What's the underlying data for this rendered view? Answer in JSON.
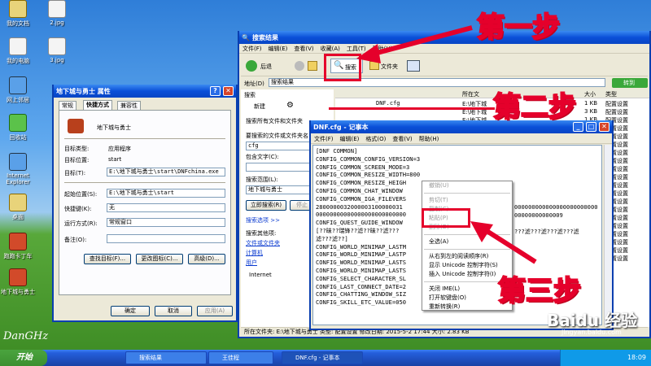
{
  "desktop": {
    "icons": [
      "我的文档",
      "2.jpg",
      "我的电脑",
      "3.jpg",
      "网上邻居",
      "回收站",
      "Internet Explorer",
      "桌面",
      "跑跑卡丁车",
      "地下城与勇士"
    ],
    "watermark": "Baidu 经验",
    "watermark_url": "jingyan.baidu.com",
    "signature": "DanGHz"
  },
  "properties": {
    "title": "地下城与勇士 属性",
    "tabs": [
      "常规",
      "快捷方式",
      "兼容性"
    ],
    "name": "地下城与勇士",
    "target_type_label": "目标类型:",
    "target_type": "应用程序",
    "target_location_label": "目标位置:",
    "target_location": "start",
    "target_label": "目标(T):",
    "target": "E:\\地下城与勇士\\start\\DNFchina.exe",
    "start_in_label": "起始位置(S):",
    "start_in": "E:\\地下城与勇士\\start",
    "shortcut_key_label": "快捷键(K):",
    "shortcut_key": "无",
    "run_label": "运行方式(R):",
    "run": "常规窗口",
    "comment_label": "备注(O):",
    "btn_find": "查找目标(F)...",
    "btn_icon": "更改图标(C)...",
    "btn_advanced": "高级(D)...",
    "btn_ok": "确定",
    "btn_cancel": "取消",
    "btn_apply": "应用(A)"
  },
  "search": {
    "title": "搜索结果",
    "menu": [
      "文件(F)",
      "编辑(E)",
      "查看(V)",
      "收藏(A)",
      "工具(T)",
      "帮助(H)"
    ],
    "back": "后退",
    "search_btn": "搜索",
    "folders_btn": "文件夹",
    "address_label": "地址(D)",
    "address": "搜索结果",
    "go": "转到",
    "pane_title": "搜索",
    "new_btn": "新建",
    "search_all": "搜索所有文件和文件夹",
    "name_label": "要搜索的文件或文件夹名",
    "name_value": "cfg",
    "contains_label": "包含文字(C):",
    "lookin_label": "搜索范围(L):",
    "lookin_value": "地下城与勇士",
    "search_now": "立即搜索(R)",
    "stop": "停止",
    "options": "搜索选项 >>",
    "other_label": "搜索其他项:",
    "other": [
      "文件或文件夹",
      "计算机",
      "用户",
      "Internet"
    ],
    "col_folder": "所在文",
    "col_size": "大小",
    "col_type": "类型",
    "result_name": "DNF.cfg",
    "result_folder": "E:\\地下城",
    "rows": [
      {
        "folder": "E:\\地下城",
        "size": "1 KB",
        "type": "配置设置"
      },
      {
        "folder": "E:\\地下城",
        "size": "3 KB",
        "type": "配置设置"
      },
      {
        "folder": "E:\\地下城",
        "size": "1 KB",
        "type": "配置设置"
      },
      {
        "folder": "E:\\地下城",
        "size": "1 KB",
        "type": "配置设置"
      },
      {
        "folder": "E:\\地下城",
        "size": "1 KB",
        "type": "配置设置"
      },
      {
        "folder": "",
        "size": "1 KB",
        "type": "配置设置"
      },
      {
        "folder": "",
        "size": "1 KB",
        "type": "配置设置"
      },
      {
        "folder": "",
        "size": "1 KB",
        "type": "配置设置"
      },
      {
        "folder": "",
        "size": "1 KB",
        "type": "配置设置"
      },
      {
        "folder": "",
        "size": "1 KB",
        "type": "配置设置"
      },
      {
        "folder": "",
        "size": "1 KB",
        "type": "配置设置"
      },
      {
        "folder": "",
        "size": "1 KB",
        "type": "配置设置"
      },
      {
        "folder": "",
        "size": "1 KB",
        "type": "配置设置"
      },
      {
        "folder": "",
        "size": "1 KB",
        "type": "配置设置"
      },
      {
        "folder": "",
        "size": "1 KB",
        "type": "配置设置"
      },
      {
        "folder": "",
        "size": "1 KB",
        "type": "配置设置"
      },
      {
        "folder": "",
        "size": "1 KB",
        "type": "配置设置"
      },
      {
        "folder": "",
        "size": "1 KB",
        "type": "配置设置"
      },
      {
        "folder": "",
        "size": "1 KB",
        "type": "配置设置"
      },
      {
        "folder": "",
        "size": "1 KB",
        "type": "配置设置"
      }
    ],
    "status": "所在文件夹: E:\\地下城与勇士 类型: 配置设置 修改日期: 2015-5-2 17:44 大小: 2.83 KB",
    "status_size": "2.83 KB"
  },
  "notepad": {
    "title": "DNF.cfg - 记事本",
    "menu": [
      "文件(F)",
      "编辑(E)",
      "格式(O)",
      "查看(V)",
      "帮助(H)"
    ],
    "lines": [
      "[DNF COMMON]",
      "CONFIG_COMMON_CONFIG_VERSION=3",
      "CONFIG_COMMON_SCREEN_MODE=3",
      "CONFIG_COMMON_RESIZE_WIDTH=800",
      "CONFIG_COMMON_RESIZE_HEIGH",
      "CONFIG_COMMON_CHAT_WINDOW",
      "CONFIG_COMMON_IGA_FILEVERS",
      "2800000032000003100000031",
      "00000000000000000000000000",
      "CONFIG_QUEST_GUIDE_WINDOW",
      "[??昧??瑞锋??滤??昧??滤???",
      "滤???滤??]",
      "CONFIG_WORLD_MINIMAP_LASTM",
      "CONFIG_WORLD_MINIMAP_LASTP",
      "CONFIG_WORLD_MINIMAP_LASTS",
      "CONFIG_WORLD_MINIMAP_LASTS",
      "CONFIG_SELECT_CHARACTER_SL",
      "CONFIG_LAST_CONNECT_DATE=2",
      "CONFIG_CHATTING_WINDOW_SIZ",
      "CONFIG_SKILL_ETC_VALUE=050"
    ],
    "right_fragments": [
      "000000000000000000000000",
      "00000000000009",
      "???滤???滤???滤???滤"
    ]
  },
  "context_menu": {
    "items": [
      "撤销(U)",
      "剪切(T)",
      "复制(C)",
      "粘贴(P)",
      "删除(D)",
      "全选(A)",
      "从右到左的阅读顺序(R)",
      "显示 Unicode 控制字符(S)",
      "插入 Unicode 控制字符(I)",
      "关闭 IME(L)",
      "打开软键盘(O)",
      "重新转换(R)"
    ]
  },
  "callouts": {
    "step1": "第一步",
    "step2": "第二步",
    "step3": "第三步"
  },
  "taskbar": {
    "start": "开始",
    "tasks": [
      "搜索结果",
      "王佳程",
      "DNF.cfg - 记事本"
    ],
    "clock": "18:09"
  },
  "colors": {
    "accent_red": "#e5002b",
    "xp_blue": "#0a4fd8",
    "taskbar": "#245edb"
  }
}
